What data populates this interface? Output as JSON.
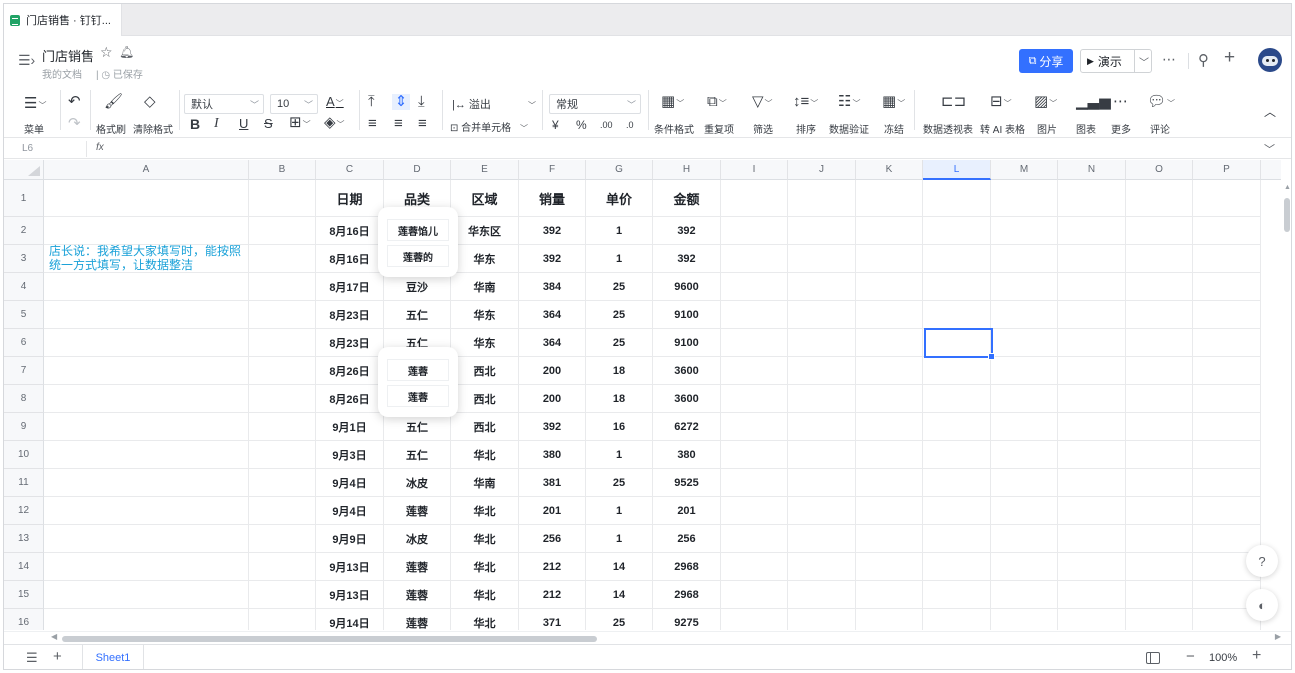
{
  "tab": {
    "title": "门店销售 · 钉钉..."
  },
  "header": {
    "title": "门店销售",
    "path": "我的文档",
    "save_status": "已保存",
    "share_label": "分享",
    "present_label": "演示"
  },
  "toolbar": {
    "menu_label": "菜单",
    "format_painter": "格式刷",
    "clear_format": "清除格式",
    "font_family": "默认",
    "font_size": "10",
    "overflow": "溢出",
    "merge_cells": "合并单元格",
    "number_format": "常规",
    "currency": "¥",
    "percent": "%",
    "conditional_format": "条件格式",
    "duplicates": "重复项",
    "filter": "筛选",
    "sort": "排序",
    "data_validation": "数据验证",
    "freeze": "冻结",
    "pivot_table": "数据透视表",
    "ai_table": "转 AI 表格",
    "image": "图片",
    "chart": "图表",
    "more": "更多",
    "comment": "评论"
  },
  "formula_bar": {
    "cell_ref": "L6",
    "fx": "fx"
  },
  "grid": {
    "columns": [
      "A",
      "B",
      "C",
      "D",
      "E",
      "F",
      "G",
      "H",
      "I",
      "J",
      "K",
      "L",
      "M",
      "N",
      "O",
      "P"
    ],
    "selected_column": "L",
    "rows": [
      "1",
      "2",
      "3",
      "4",
      "5",
      "6",
      "7",
      "8",
      "9",
      "10",
      "11",
      "12",
      "13",
      "14",
      "15",
      "16"
    ],
    "table_headers": [
      "日期",
      "品类",
      "区域",
      "销量",
      "单价",
      "金额"
    ],
    "table_rows": [
      [
        "8月16日",
        "",
        "华东区",
        "392",
        "1",
        "392"
      ],
      [
        "8月16日",
        "",
        "华东",
        "392",
        "1",
        "392"
      ],
      [
        "8月17日",
        "豆沙",
        "华南",
        "384",
        "25",
        "9600"
      ],
      [
        "8月23日",
        "五仁",
        "华东",
        "364",
        "25",
        "9100"
      ],
      [
        "8月23日",
        "五仁",
        "华东",
        "364",
        "25",
        "9100"
      ],
      [
        "8月26日",
        "",
        "西北",
        "200",
        "18",
        "3600"
      ],
      [
        "8月26日",
        "",
        "西北",
        "200",
        "18",
        "3600"
      ],
      [
        "9月1日",
        "五仁",
        "西北",
        "392",
        "16",
        "6272"
      ],
      [
        "9月3日",
        "五仁",
        "华北",
        "380",
        "1",
        "380"
      ],
      [
        "9月4日",
        "冰皮",
        "华南",
        "381",
        "25",
        "9525"
      ],
      [
        "9月4日",
        "莲蓉",
        "华北",
        "201",
        "1",
        "201"
      ],
      [
        "9月9日",
        "冰皮",
        "华北",
        "256",
        "1",
        "256"
      ],
      [
        "9月13日",
        "莲蓉",
        "华北",
        "212",
        "14",
        "2968"
      ],
      [
        "9月13日",
        "莲蓉",
        "华北",
        "212",
        "14",
        "2968"
      ],
      [
        "9月14日",
        "莲蓉",
        "华北",
        "371",
        "25",
        "9275"
      ]
    ],
    "note": "店长说：我希望大家填写时，能按照统一方式填写，让数据整洁",
    "callout_top": [
      "莲蓉馅儿",
      "莲蓉的"
    ],
    "callout_bottom": [
      "莲蓉",
      "莲蓉"
    ]
  },
  "bottom": {
    "sheet_name": "Sheet1",
    "zoom": "100%"
  },
  "colors": {
    "accent": "#3370ff",
    "note": "#1aa1d8"
  }
}
